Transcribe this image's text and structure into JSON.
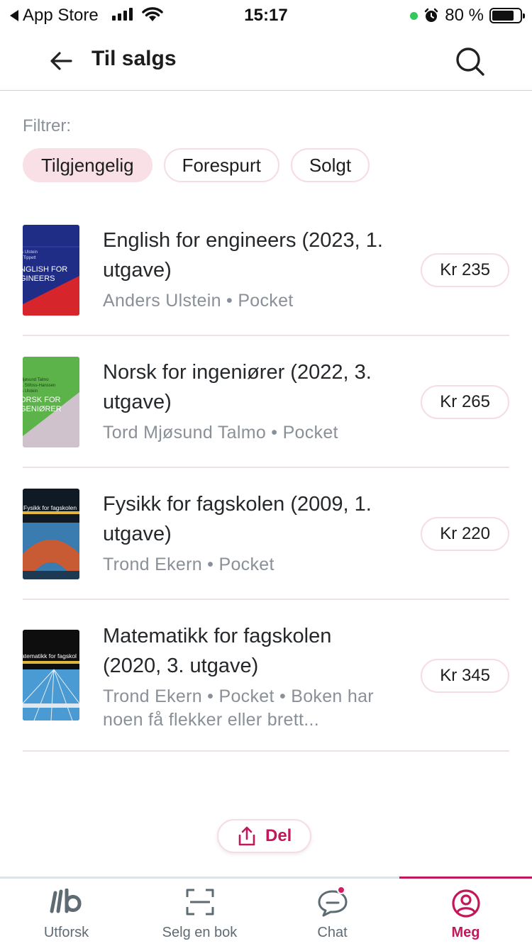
{
  "status_bar": {
    "back_app": "App Store",
    "time": "15:17",
    "battery": "80 %"
  },
  "header": {
    "title": "Til salgs",
    "back_icon": "arrow-left-icon",
    "search_icon": "search-icon"
  },
  "filter": {
    "label": "Filtrer:",
    "chips": [
      {
        "label": "Tilgjengelig",
        "active": true
      },
      {
        "label": "Forespurt",
        "active": false
      },
      {
        "label": "Solgt",
        "active": false
      }
    ]
  },
  "books": [
    {
      "title": "English for engineers (2023, 1. utgave)",
      "meta": "Anders Ulstein • Pocket",
      "price": "Kr 235",
      "cover": "English for engineers cover"
    },
    {
      "title": "Norsk for ingeniører (2022, 3. utgave)",
      "meta": "Tord Mjøsund Talmo • Pocket",
      "price": "Kr 265",
      "cover": "Norsk for ingeniører cover"
    },
    {
      "title": "Fysikk for fagskolen (2009, 1. utgave)",
      "meta": "Trond Ekern • Pocket",
      "price": "Kr 220",
      "cover": "Fysikk for fagskolen cover"
    },
    {
      "title": "Matematikk for fagskolen (2020, 3. utgave)",
      "meta": "Trond Ekern • Pocket • Boken har noen få flekker eller brett...",
      "price": "Kr 345",
      "cover": "Matematikk for fagskolen cover"
    }
  ],
  "share": {
    "label": "Del",
    "icon": "share-icon"
  },
  "tabs": [
    {
      "label": "Utforsk",
      "icon": "logo-icon",
      "active": false
    },
    {
      "label": "Selg en bok",
      "icon": "scan-icon",
      "active": false
    },
    {
      "label": "Chat",
      "icon": "chat-icon",
      "active": false
    },
    {
      "label": "Meg",
      "icon": "profile-icon",
      "active": true
    }
  ],
  "colors": {
    "accent": "#c2185b",
    "chip_active_bg": "#f9e0e6",
    "chip_border": "#f5dde3",
    "muted_text": "#8a9097",
    "divider": "#f1dfe5"
  }
}
